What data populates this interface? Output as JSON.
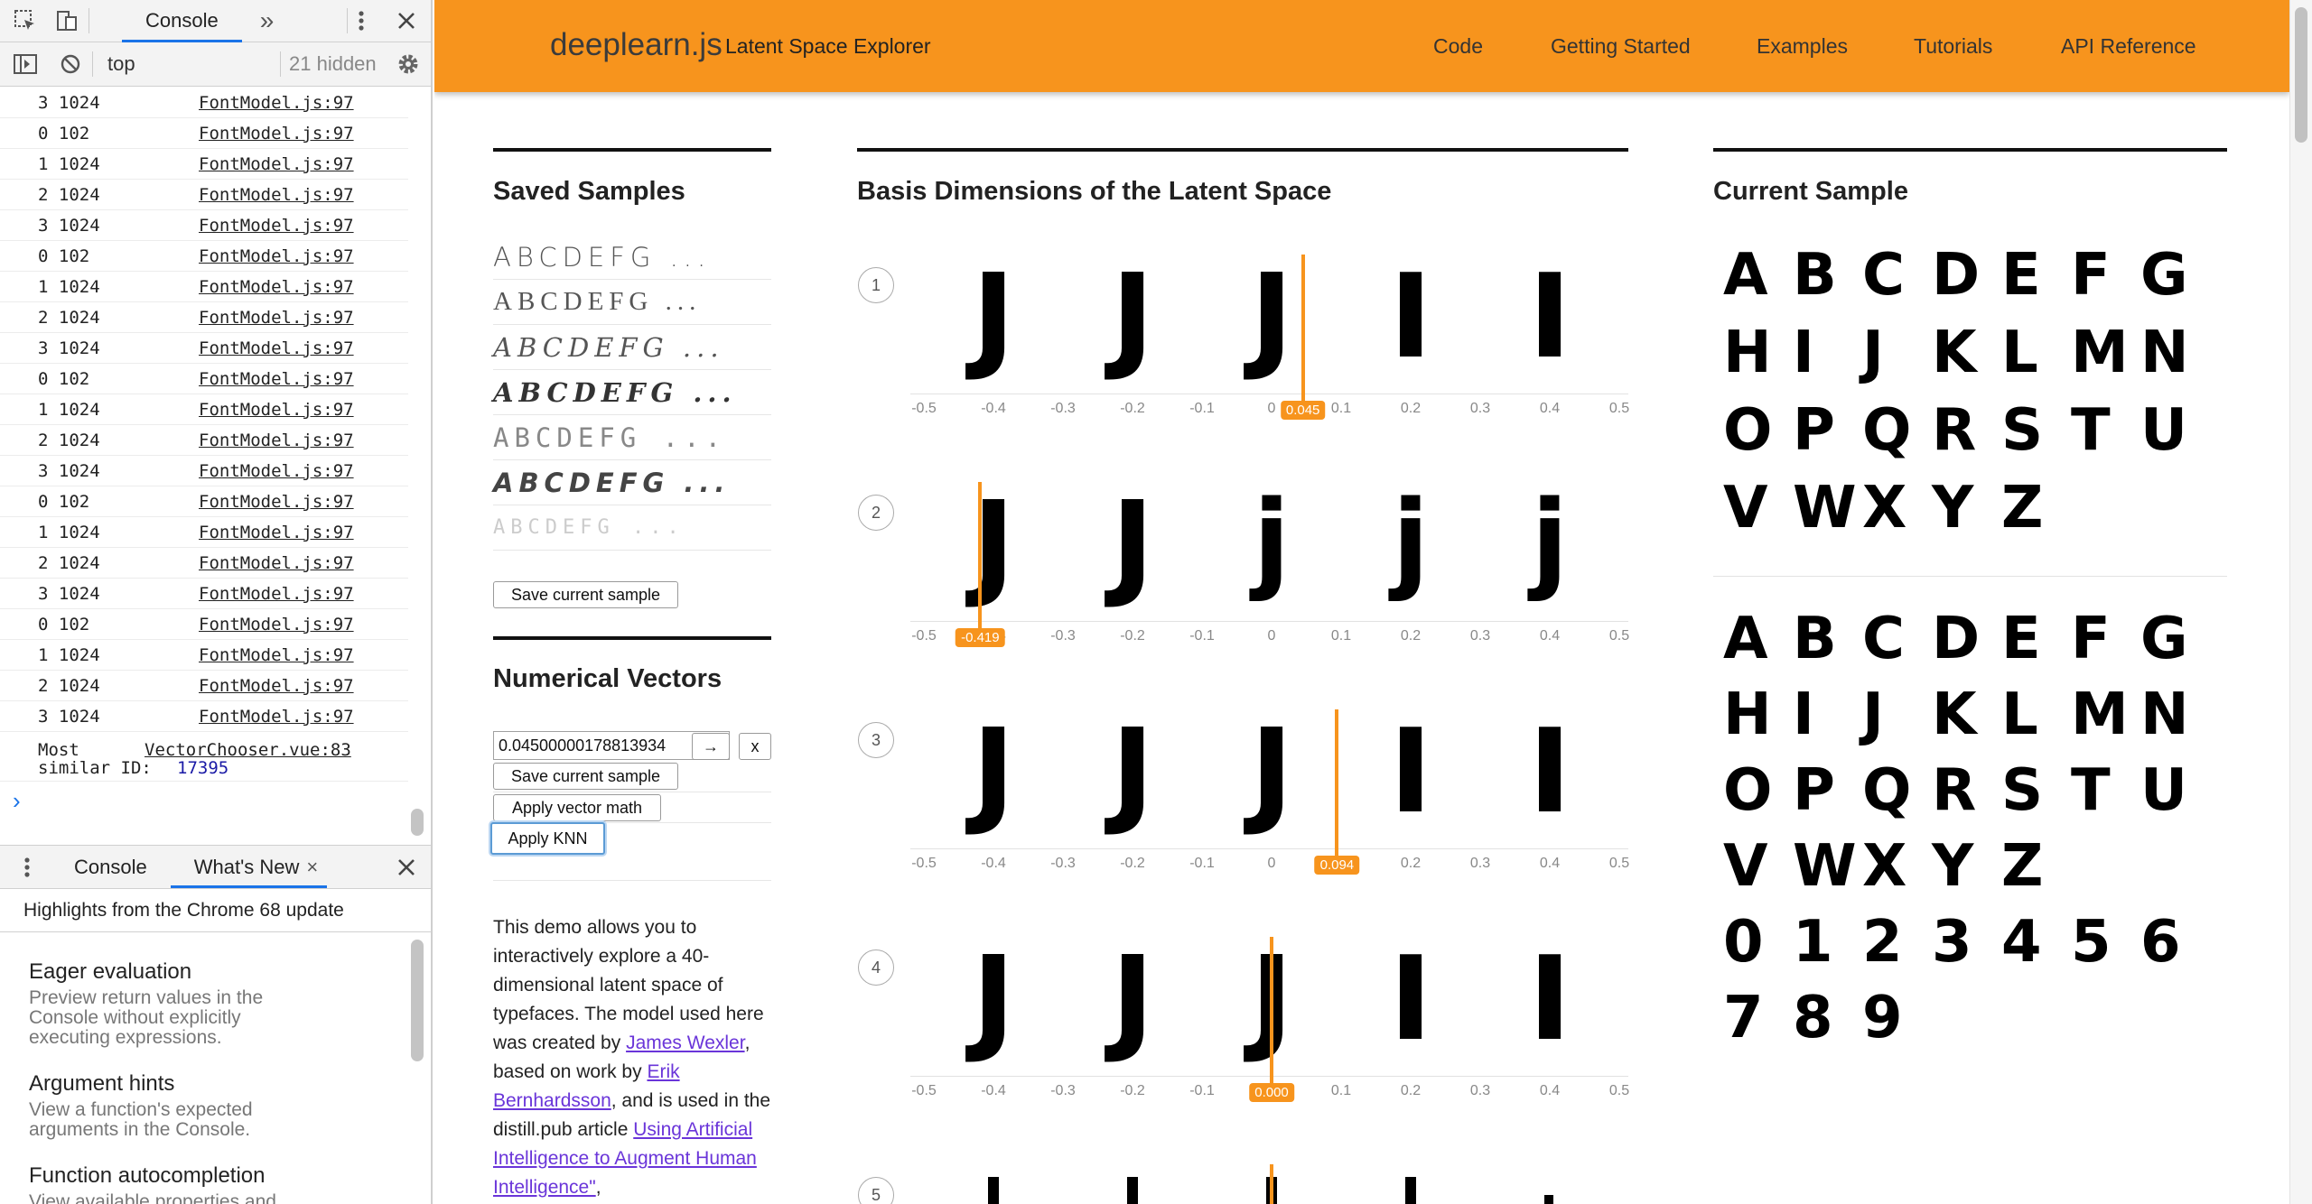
{
  "devtools": {
    "tabs": [
      "Console"
    ],
    "more_tabs_glyph": "»",
    "context": "top",
    "hidden_count": "21 hidden",
    "log_rows": [
      {
        "msg": "3 1024",
        "src": "FontModel.js:97"
      },
      {
        "msg": "0 102",
        "src": "FontModel.js:97"
      },
      {
        "msg": "1 1024",
        "src": "FontModel.js:97"
      },
      {
        "msg": "2 1024",
        "src": "FontModel.js:97"
      },
      {
        "msg": "3 1024",
        "src": "FontModel.js:97"
      },
      {
        "msg": "0 102",
        "src": "FontModel.js:97"
      },
      {
        "msg": "1 1024",
        "src": "FontModel.js:97"
      },
      {
        "msg": "2 1024",
        "src": "FontModel.js:97"
      },
      {
        "msg": "3 1024",
        "src": "FontModel.js:97"
      },
      {
        "msg": "0 102",
        "src": "FontModel.js:97"
      },
      {
        "msg": "1 1024",
        "src": "FontModel.js:97"
      },
      {
        "msg": "2 1024",
        "src": "FontModel.js:97"
      },
      {
        "msg": "3 1024",
        "src": "FontModel.js:97"
      },
      {
        "msg": "0 102",
        "src": "FontModel.js:97"
      },
      {
        "msg": "1 1024",
        "src": "FontModel.js:97"
      },
      {
        "msg": "2 1024",
        "src": "FontModel.js:97"
      },
      {
        "msg": "3 1024",
        "src": "FontModel.js:97"
      },
      {
        "msg": "0 102",
        "src": "FontModel.js:97"
      },
      {
        "msg": "1 1024",
        "src": "FontModel.js:97"
      },
      {
        "msg": "2 1024",
        "src": "FontModel.js:97"
      },
      {
        "msg": "3 1024",
        "src": "FontModel.js:97"
      }
    ],
    "similar_label_1": "Most",
    "similar_label_2": "similar ID:",
    "similar_id": "17395",
    "similar_src": "VectorChooser.vue:83",
    "prompt": "›",
    "drawer": {
      "tab_console": "Console",
      "tab_whats_new": "What's New",
      "highlights": "Highlights from the Chrome 68 update",
      "items": [
        {
          "title": "Eager evaluation",
          "desc": "Preview return values in the Console without explicitly executing expressions."
        },
        {
          "title": "Argument hints",
          "desc": "View a function's expected arguments in the Console."
        },
        {
          "title": "Function autocompletion",
          "desc": "View available properties and"
        }
      ]
    }
  },
  "header": {
    "brand": "deeplearn.js",
    "subtitle": "Latent Space Explorer",
    "nav": [
      "Code",
      "Getting Started",
      "Examples",
      "Tutorials",
      "API Reference"
    ]
  },
  "saved_samples": {
    "title": "Saved Samples",
    "samples": [
      "ABCDEFG ...",
      "ABCDEFG ...",
      "ABCDEFG ...",
      "ABCDEFG ...",
      "ABCDEFG ...",
      "ABCDEFG ...",
      "ABCDEFG ..."
    ],
    "save_button": "Save current sample"
  },
  "numerical": {
    "title": "Numerical Vectors",
    "input_value": "0.04500000178813934",
    "arrow_button": "→",
    "x_button": "x",
    "save_button": "Save current sample",
    "vector_math_button": "Apply vector math",
    "knn_button": "Apply KNN"
  },
  "description": {
    "p1": "This demo allows you to interactively explore a 40-dimensional latent space of typefaces. The model used here was created by ",
    "link1": "James Wexler",
    "p2": ", based on work by ",
    "link2": "Erik Bernhardsson",
    "p3": ", and is used in the distill.pub article ",
    "link3": "Using Artificial Intelligence to Augment Human Intelligence\"",
    "p4": ","
  },
  "basis": {
    "title": "Basis Dimensions of the Latent Space",
    "ticks": [
      "-0.5",
      "-0.4",
      "-0.3",
      "-0.2",
      "-0.1",
      "0",
      "0.1",
      "0.2",
      "0.3",
      "0.4",
      "0.5"
    ],
    "rows": [
      {
        "num": "1",
        "glyphs": [
          "J",
          "J",
          "J",
          "I",
          "I"
        ],
        "value": 0.045,
        "label": "0.045"
      },
      {
        "num": "2",
        "glyphs": [
          "J",
          "J",
          "j",
          "j",
          "j"
        ],
        "value": -0.419,
        "label": "-0.419"
      },
      {
        "num": "3",
        "glyphs": [
          "J",
          "J",
          "J",
          "I",
          "I"
        ],
        "value": 0.094,
        "label": "0.094"
      },
      {
        "num": "4",
        "glyphs": [
          "J",
          "J",
          "J",
          "I",
          "I"
        ],
        "value": 0.0,
        "label": "0.000"
      },
      {
        "num": "5",
        "glyphs": [],
        "value": 0.0,
        "label": ""
      }
    ]
  },
  "current": {
    "title": "Current Sample",
    "grid1": [
      [
        "A",
        "B",
        "C",
        "D",
        "E",
        "F",
        "G"
      ],
      [
        "H",
        "I",
        "J",
        "K",
        "L",
        "M",
        "N"
      ],
      [
        "O",
        "P",
        "Q",
        "R",
        "S",
        "T",
        "U"
      ],
      [
        "V",
        "W",
        "X",
        "Y",
        "Z"
      ]
    ],
    "grid2": [
      [
        "A",
        "B",
        "C",
        "D",
        "E",
        "F",
        "G"
      ],
      [
        "H",
        "I",
        "J",
        "K",
        "L",
        "M",
        "N"
      ],
      [
        "O",
        "P",
        "Q",
        "R",
        "S",
        "T",
        "U"
      ],
      [
        "V",
        "W",
        "X",
        "Y",
        "Z"
      ],
      [
        "0",
        "1",
        "2",
        "3",
        "4",
        "5",
        "6"
      ],
      [
        "7",
        "8",
        "9"
      ]
    ]
  },
  "colors": {
    "accent": "#f7941d",
    "link": "#6a35d9"
  }
}
